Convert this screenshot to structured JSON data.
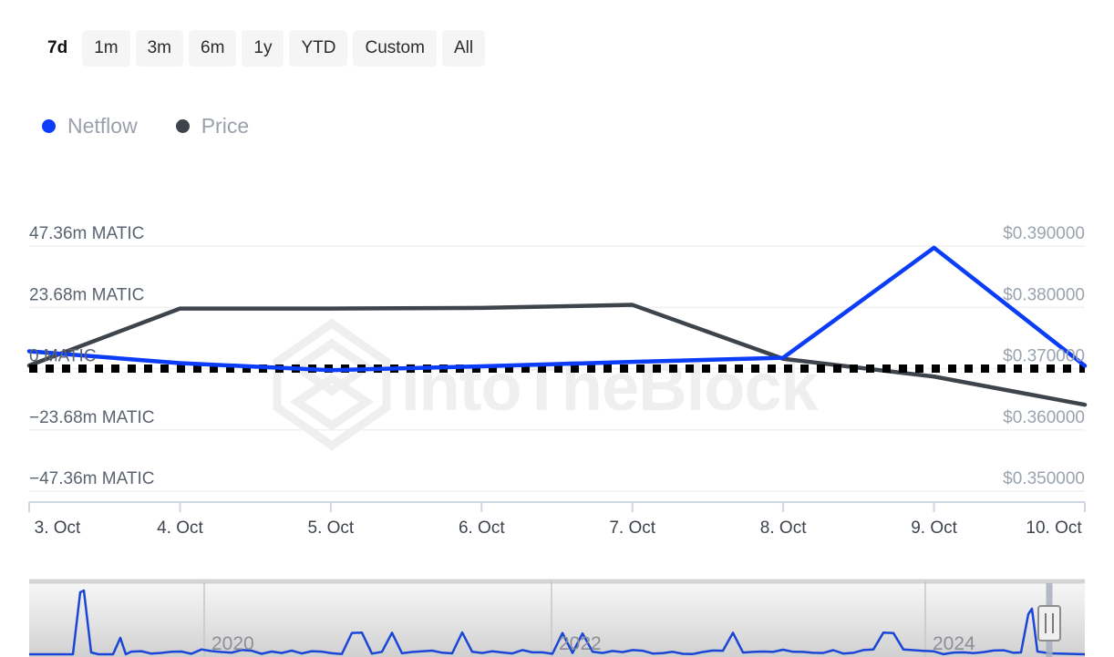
{
  "range_selector": {
    "buttons": [
      {
        "label": "7d",
        "active": true
      },
      {
        "label": "1m",
        "active": false
      },
      {
        "label": "3m",
        "active": false
      },
      {
        "label": "6m",
        "active": false
      },
      {
        "label": "1y",
        "active": false
      },
      {
        "label": "YTD",
        "active": false
      },
      {
        "label": "Custom",
        "active": false
      },
      {
        "label": "All",
        "active": false
      }
    ]
  },
  "legend": {
    "items": [
      {
        "label": "Netflow",
        "color": "#0b3cf7"
      },
      {
        "label": "Price",
        "color": "#3e444b"
      }
    ]
  },
  "watermark": {
    "text": "IntoTheBlock",
    "logo": "intotheblock-diamond-logo"
  },
  "chart_data": {
    "type": "line",
    "title": "",
    "xlabel": "",
    "ylabel": "Netflow",
    "y2label": "Price",
    "grid": true,
    "legend_position": "top-left",
    "x": [
      "3. Oct",
      "4. Oct",
      "5. Oct",
      "6. Oct",
      "7. Oct",
      "8. Oct",
      "9. Oct",
      "10. Oct"
    ],
    "left_axis": {
      "ticks": [
        "47.36m MATIC",
        "23.68m MATIC",
        "0 MATIC",
        "−23.68m MATIC",
        "−47.36m MATIC"
      ],
      "values": [
        47360000,
        23680000,
        0,
        -23680000,
        -47360000
      ],
      "unit": "MATIC",
      "ylim": [
        -47360000,
        47360000
      ]
    },
    "right_axis": {
      "ticks": [
        "$0.390000",
        "$0.380000",
        "$0.370000",
        "$0.360000",
        "$0.350000"
      ],
      "values": [
        0.39,
        0.38,
        0.37,
        0.36,
        0.35
      ],
      "unit": "USD",
      "ylim": [
        0.35,
        0.39
      ]
    },
    "zero_line": {
      "value": 0,
      "style": "dotted",
      "color": "#000000"
    },
    "series": [
      {
        "name": "Netflow",
        "axis": "left",
        "color": "#0b3cf7",
        "values": [
          6700000,
          2100000,
          -600000,
          900000,
          2600000,
          4200000,
          46700000,
          1100000
        ]
      },
      {
        "name": "Price",
        "axis": "right",
        "color": "#3e444b",
        "values": [
          0.3705,
          0.3798,
          0.3798,
          0.3799,
          0.3804,
          0.3716,
          0.3687,
          0.3641
        ]
      }
    ]
  },
  "navigator": {
    "years": [
      "2020",
      "2022",
      "2024"
    ],
    "handle": "navigator-right-handle"
  }
}
